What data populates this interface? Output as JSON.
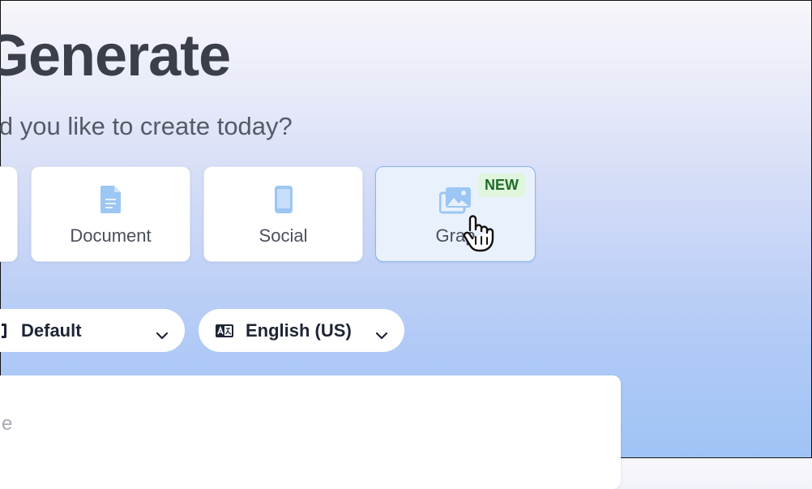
{
  "header": {
    "title": "Generate",
    "subtitle": "ld you like to create today?"
  },
  "options": [
    {
      "id": "document",
      "label": "Document",
      "icon": "document-icon"
    },
    {
      "id": "social",
      "label": "Social",
      "icon": "phone-icon"
    },
    {
      "id": "graphic",
      "label": "Grap",
      "icon": "images-icon",
      "badge": "NEW",
      "hovered": true
    }
  ],
  "selectors": {
    "theme": {
      "selected": "Default",
      "icon": "theme-icon"
    },
    "language": {
      "selected": "English (US)",
      "icon": "language-icon"
    }
  },
  "prompt": {
    "placeholder_fragment": "e"
  },
  "colors": {
    "accent_light": "#e9f1fd",
    "accent_border": "#8fb6ec",
    "badge_bg": "#dff6dc",
    "badge_text": "#1f6b2a",
    "icon_blue": "#9cc6f3"
  }
}
